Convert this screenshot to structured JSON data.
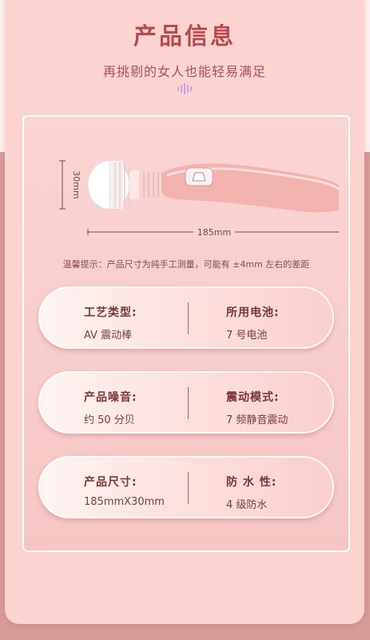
{
  "header": {
    "title": "产品信息",
    "subtitle": "再挑剔的女人也能轻易满足"
  },
  "figure": {
    "height_dimension": "30mm",
    "length_dimension": "185mm"
  },
  "tip": "温馨提示：产品尺寸为纯手工测量，可能有 ±4mm 左右的差距",
  "specs": [
    {
      "left": {
        "label": "工艺类型:",
        "value": "AV 震动棒"
      },
      "right": {
        "label": "所用电池:",
        "value": "7 号电池"
      }
    },
    {
      "left": {
        "label": "产品噪音:",
        "value": "约 50 分贝"
      },
      "right": {
        "label": "震动模式:",
        "value": "7 频静音震动"
      }
    },
    {
      "left": {
        "label": "产品尺寸:",
        "value": "185mmX30mm"
      },
      "right": {
        "label": "防 水 性:",
        "value": "4 级防水"
      }
    }
  ],
  "colors": {
    "accent": "#b84a4a",
    "background": "#fbd3d0",
    "product_body": "#f4b8b6"
  }
}
